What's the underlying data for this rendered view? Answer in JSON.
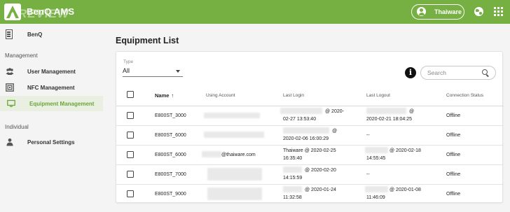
{
  "header": {
    "app_title": "BenQ AMS",
    "watermark": "REVIEW",
    "user_name": "Thaiware",
    "accent_color": "#76b043"
  },
  "sidebar": {
    "company": "BenQ",
    "sections": [
      {
        "title": "Management",
        "items": [
          {
            "label": "User Management",
            "icon": "users-icon",
            "active": false
          },
          {
            "label": "NFC Management",
            "icon": "nfc-icon",
            "active": false
          },
          {
            "label": "Equipment Management",
            "icon": "monitor-icon",
            "active": true
          }
        ]
      },
      {
        "title": "Individual",
        "items": [
          {
            "label": "Personal Settings",
            "icon": "person-icon",
            "active": false
          }
        ]
      }
    ]
  },
  "main": {
    "title": "Equipment List",
    "filter": {
      "label": "Type",
      "value": "All"
    },
    "search": {
      "placeholder": "Search"
    },
    "table": {
      "columns": [
        "Name",
        "Using Account",
        "Last Login",
        "Last Logout",
        "Connection Status"
      ],
      "sort_indicator": "↑",
      "rows": [
        {
          "name": "E800ST_3000",
          "account": "",
          "last_login_1": "@ 2020-",
          "last_login_2": "02-27 13:53:40",
          "last_logout_1": "@",
          "last_logout_2": "2020-02-21 18:04:25",
          "status": "Offline"
        },
        {
          "name": "E800ST_6000",
          "account": "",
          "last_login_1": "@",
          "last_login_2": "2020-02-06 16:00:29",
          "last_logout_1": "--",
          "last_logout_2": "",
          "status": "Offline"
        },
        {
          "name": "E800ST_6000",
          "account": "@thaiware.com",
          "last_login_1": "Thaiware @ 2020-02-25",
          "last_login_2": "16:35:40",
          "last_logout_1": "@ 2020-02-18",
          "last_logout_2": "14:55:45",
          "status": "Offline"
        },
        {
          "name": "E800ST_7000",
          "account": "",
          "last_login_1": "@ 2020-02-20",
          "last_login_2": "14:15:59",
          "last_logout_1": "--",
          "last_logout_2": "",
          "status": "Offline"
        },
        {
          "name": "E800ST_9000",
          "account": "",
          "last_login_1": "@ 2020-01-24",
          "last_login_2": "11:32:58",
          "last_logout_1": "@ 2020-01-08",
          "last_logout_2": "11:46:09",
          "status": "Offline"
        }
      ]
    }
  }
}
